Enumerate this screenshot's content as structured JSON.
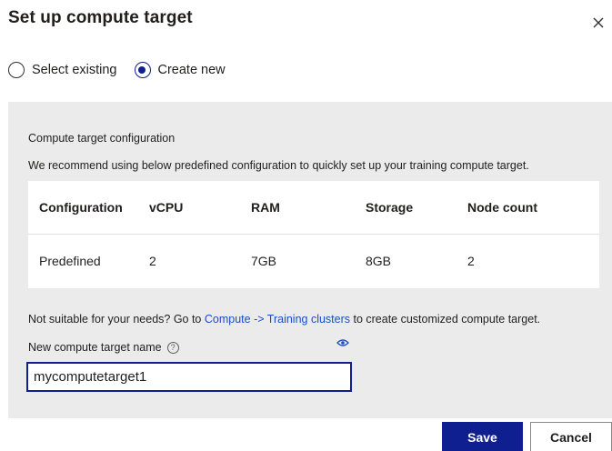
{
  "dialog": {
    "title": "Set up compute target",
    "close_icon": "close-icon"
  },
  "mode": {
    "options": [
      {
        "label": "Select existing",
        "selected": false
      },
      {
        "label": "Create new",
        "selected": true
      }
    ]
  },
  "config": {
    "heading": "Compute target configuration",
    "recommendation": "We recommend using below predefined configuration to quickly set up your training compute target.",
    "table": {
      "columns": [
        "Configuration",
        "vCPU",
        "RAM",
        "Storage",
        "Node count"
      ],
      "rows": [
        [
          "Predefined",
          "2",
          "7GB",
          "8GB",
          "2"
        ]
      ]
    },
    "not_suitable_prefix": "Not suitable for your needs? Go to ",
    "link_text": "Compute -> Training clusters",
    "not_suitable_suffix": " to create customized compute target.",
    "name_label": "New compute target name",
    "help_icon": "help-icon",
    "eye_icon": "eye-icon",
    "name_value": "mycomputetarget1"
  },
  "footer": {
    "save_label": "Save",
    "cancel_label": "Cancel"
  },
  "colors": {
    "accent": "#0f1f8f",
    "link": "#1a4fc4",
    "panel_bg": "#ebebeb"
  }
}
